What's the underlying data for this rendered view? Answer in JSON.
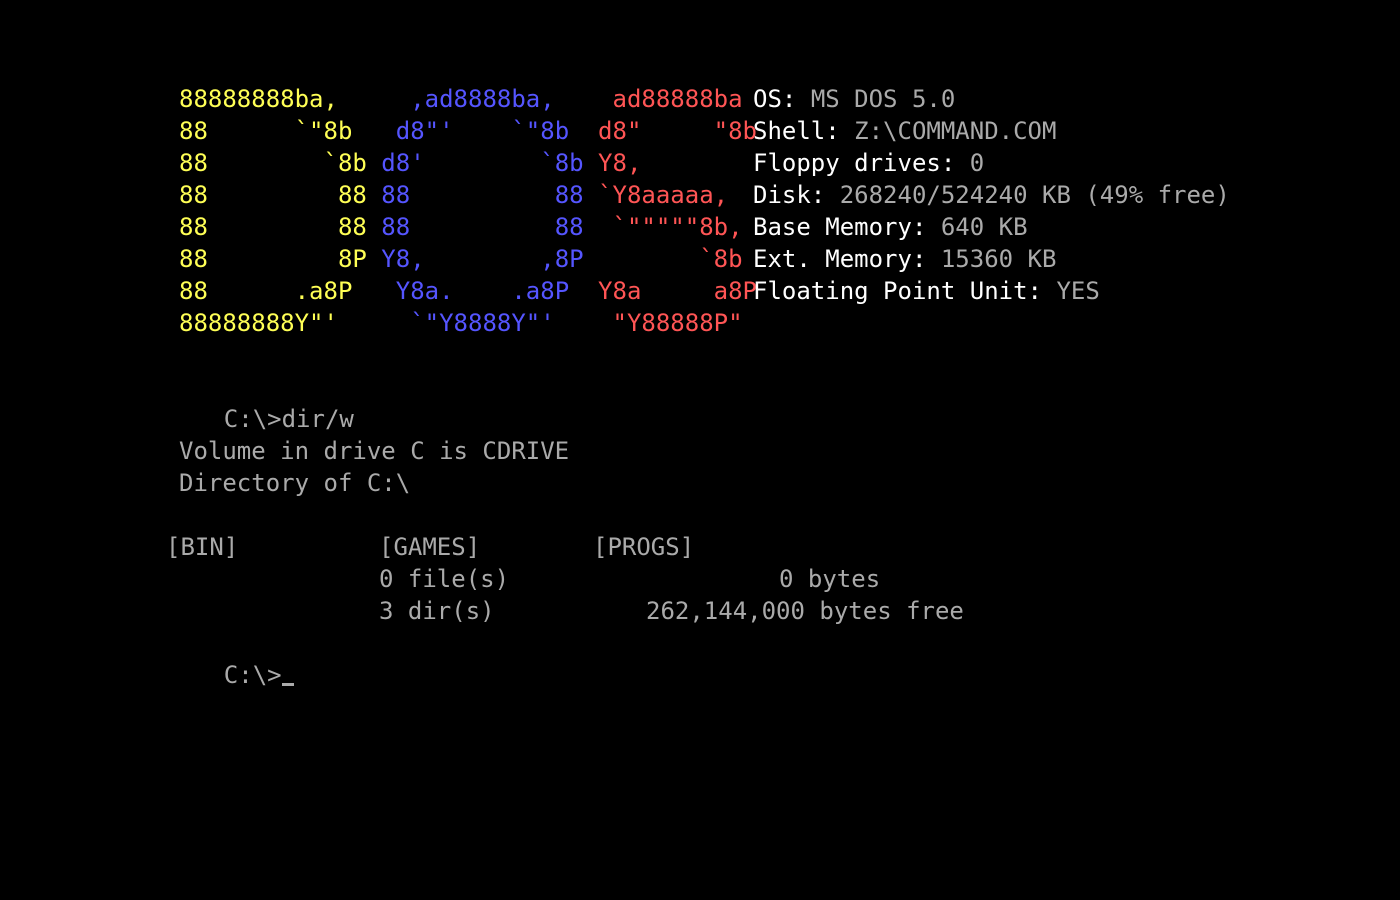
{
  "logo": {
    "colors": {
      "d": "#FFFF55",
      "o": "#5555FF",
      "s": "#FF5555"
    },
    "rows": [
      {
        "d": "88888888ba,",
        "d_pad": "     ",
        "o": ",ad8888ba,",
        "o_pad": "    ",
        "s": "ad88888ba"
      },
      {
        "d": "88      `\"8b",
        "d_pad": "   ",
        "o": "d8\"'    `\"8b",
        "o_pad": "  ",
        "s": "d8\"     \"8b"
      },
      {
        "d": "88        `8b",
        "d_pad": " ",
        "o": "d8'        `8b",
        "o_pad": " ",
        "s": "Y8,"
      },
      {
        "d": "88         88",
        "d_pad": " ",
        "o": "88          88",
        "o_pad": " ",
        "s": "`Y8aaaaa,"
      },
      {
        "d": "88         88",
        "d_pad": " ",
        "o": "88          88",
        "o_pad": "  ",
        "s": "`\"\"\"\"\"8b,"
      },
      {
        "d": "88         8P",
        "d_pad": " ",
        "o": "Y8,        ,8P",
        "o_pad": "        ",
        "s": "`8b"
      },
      {
        "d": "88      .a8P",
        "d_pad": "   ",
        "o": "Y8a.    .a8P",
        "o_pad": "  ",
        "s": "Y8a     a8P"
      },
      {
        "d": "88888888Y\"'",
        "d_pad": "     ",
        "o": "`\"Y8888Y\"'",
        "o_pad": "    ",
        "s": "\"Y88888P\""
      }
    ]
  },
  "sysinfo": [
    {
      "label": "OS:",
      "value": "MS DOS 5.0"
    },
    {
      "label": "Shell:",
      "value": "Z:\\COMMAND.COM"
    },
    {
      "label": "Floppy drives:",
      "value": "0"
    },
    {
      "label": "Disk:",
      "value": "268240/524240 KB (49% free)"
    },
    {
      "label": "Base Memory:",
      "value": "640 KB"
    },
    {
      "label": "Ext. Memory:",
      "value": "15360 KB"
    },
    {
      "label": "Floating Point Unit:",
      "value": "YES"
    }
  ],
  "terminal": {
    "command_line": "C:\\>dir/w",
    "volume_line": "Volume in drive C is CDRIVE",
    "directory_line": "Directory of C:\\",
    "entries": [
      "[BIN]",
      "[GAMES]",
      "[PROGS]"
    ],
    "files_count": "0 file(s)",
    "files_bytes": "0 bytes",
    "dirs_count": "3 dir(s)",
    "dirs_bytes_free": "262,144,000 bytes free",
    "prompt": "C:\\>"
  }
}
